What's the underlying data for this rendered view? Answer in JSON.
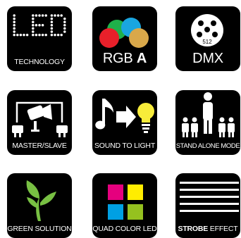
{
  "tiles": [
    {
      "id": "led-technology",
      "title": "LED",
      "label": "TECHNOLOGY"
    },
    {
      "id": "rgba",
      "label_main": "RGB",
      "label_bold": "A",
      "colors": {
        "red": "#e8202a",
        "green": "#1fb14a",
        "blue": "#1aa6e0",
        "amber": "#d9a84a"
      }
    },
    {
      "id": "dmx",
      "label": "DMX",
      "connector_text": "512"
    },
    {
      "id": "master-slave",
      "label": "MASTER/SLAVE"
    },
    {
      "id": "sound-to-light",
      "label": "SOUND TO LIGHT",
      "bulb_color": "#f7ec3a"
    },
    {
      "id": "stand-alone-mode",
      "label": "STAND ALONE MODE"
    },
    {
      "id": "green-solution",
      "label": "GREEN SOLUTION",
      "leaf_color": "#78c043"
    },
    {
      "id": "quad-color-led",
      "label": "QUAD COLOR LED",
      "colors": {
        "magenta": "#e5007e",
        "yellow": "#ffed00",
        "cyan": "#00a0e3",
        "green": "#95c11f"
      }
    },
    {
      "id": "strobe-effect",
      "label_bold": "STROBE",
      "label_rest": " EFFECT"
    }
  ]
}
